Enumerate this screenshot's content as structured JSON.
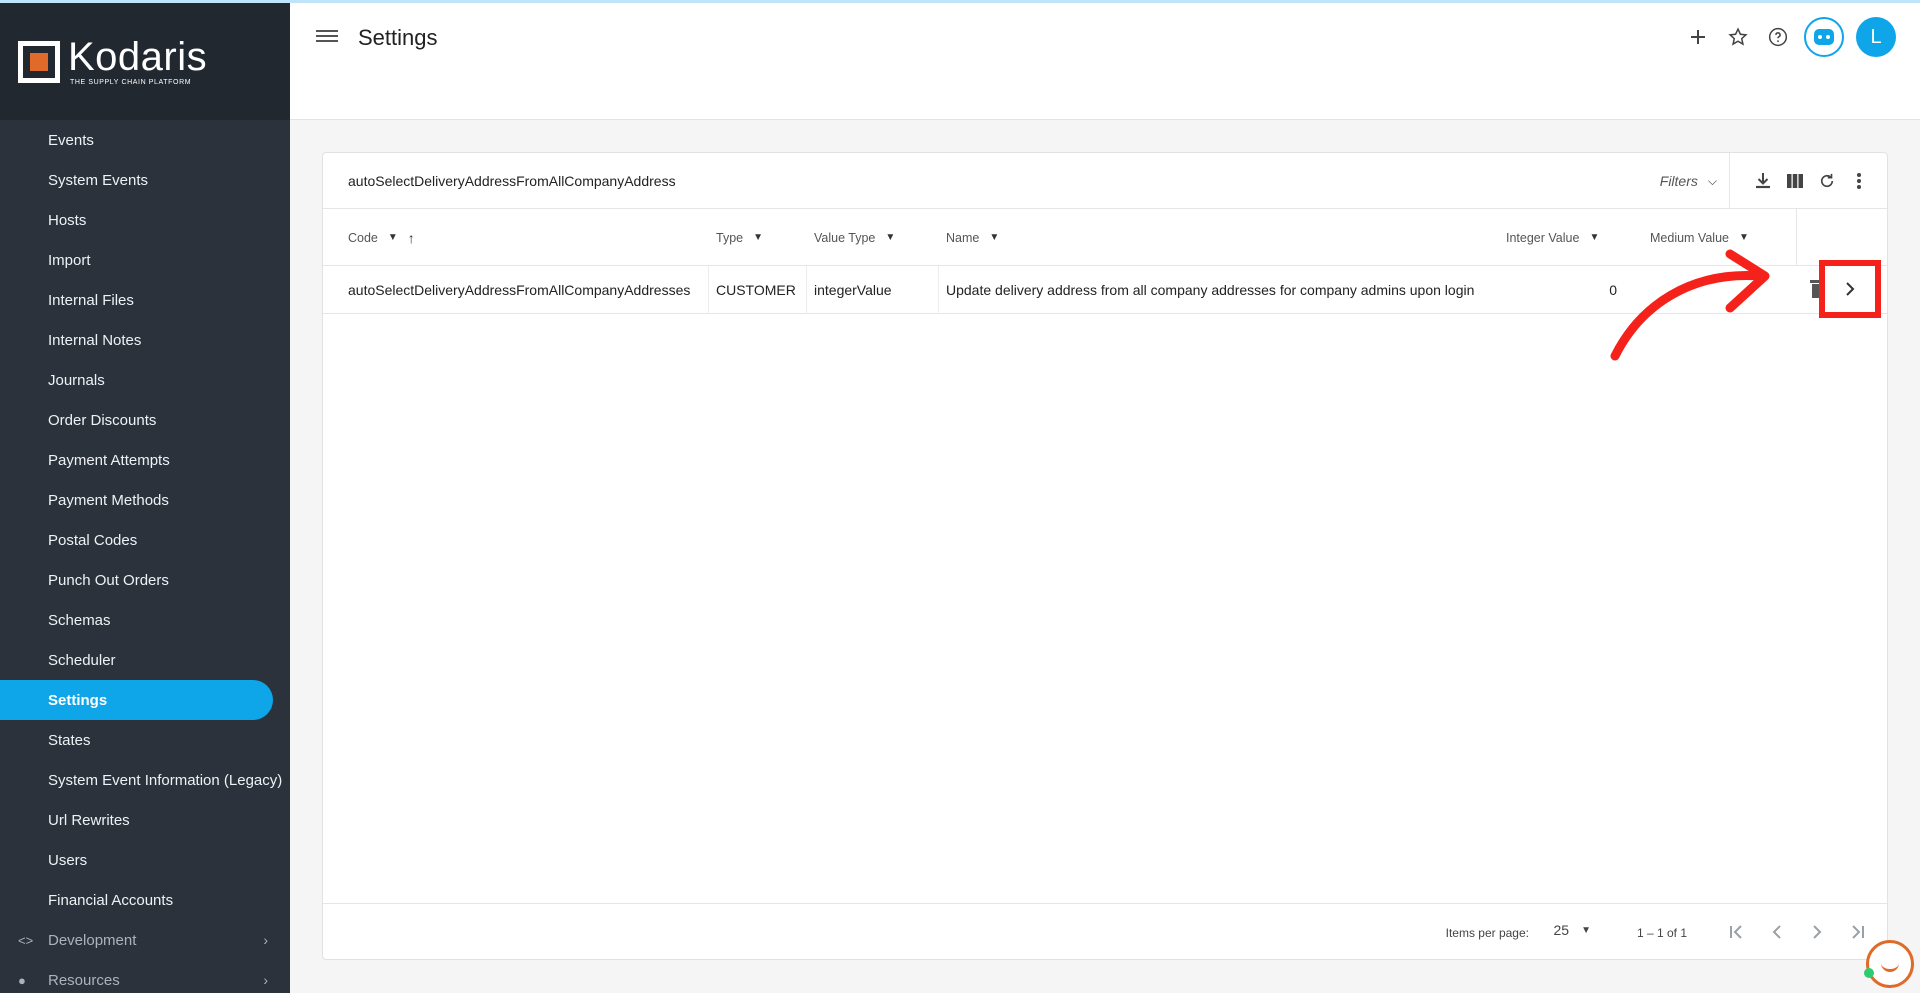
{
  "app": {
    "logo_name": "Kodaris",
    "logo_tagline": "THE SUPPLY CHAIN PLATFORM"
  },
  "sidebar": {
    "items": [
      {
        "label": "Events"
      },
      {
        "label": "System Events"
      },
      {
        "label": "Hosts"
      },
      {
        "label": "Import"
      },
      {
        "label": "Internal Files"
      },
      {
        "label": "Internal Notes"
      },
      {
        "label": "Journals"
      },
      {
        "label": "Order Discounts"
      },
      {
        "label": "Payment Attempts"
      },
      {
        "label": "Payment Methods"
      },
      {
        "label": "Postal Codes"
      },
      {
        "label": "Punch Out Orders"
      },
      {
        "label": "Schemas"
      },
      {
        "label": "Scheduler"
      },
      {
        "label": "Settings"
      },
      {
        "label": "States"
      },
      {
        "label": "System Event Information (Legacy)"
      },
      {
        "label": "Url Rewrites"
      },
      {
        "label": "Users"
      },
      {
        "label": "Financial Accounts"
      }
    ],
    "active": "Settings",
    "groups": [
      {
        "label": "Development",
        "icon": "code-icon"
      },
      {
        "label": "Resources",
        "icon": "help-circle-icon"
      }
    ]
  },
  "header": {
    "title": "Settings",
    "avatar_letter": "L",
    "icons": [
      "add-icon",
      "star-icon",
      "help-icon",
      "bot-icon"
    ]
  },
  "table": {
    "search_value": "autoSelectDeliveryAddressFromAllCompanyAddress",
    "filters_label": "Filters",
    "columns": [
      "Code",
      "Type",
      "Value Type",
      "Name",
      "Integer Value",
      "Medium Value"
    ],
    "rows": [
      {
        "code": "autoSelectDeliveryAddressFromAllCompanyAddresses",
        "type": "CUSTOMER",
        "value_type": "integerValue",
        "name": "Update delivery address from all company addresses for company admins upon login",
        "integer_value": "0",
        "medium_value": ""
      }
    ]
  },
  "footer": {
    "items_per_page_label": "Items per page:",
    "items_per_page": "25",
    "range": "1 – 1 of 1"
  },
  "colors": {
    "accent": "#0ea5e9",
    "sidebar": "#2b323b",
    "brand_orange": "#e06a2a",
    "annotation_red": "#f5221b"
  }
}
